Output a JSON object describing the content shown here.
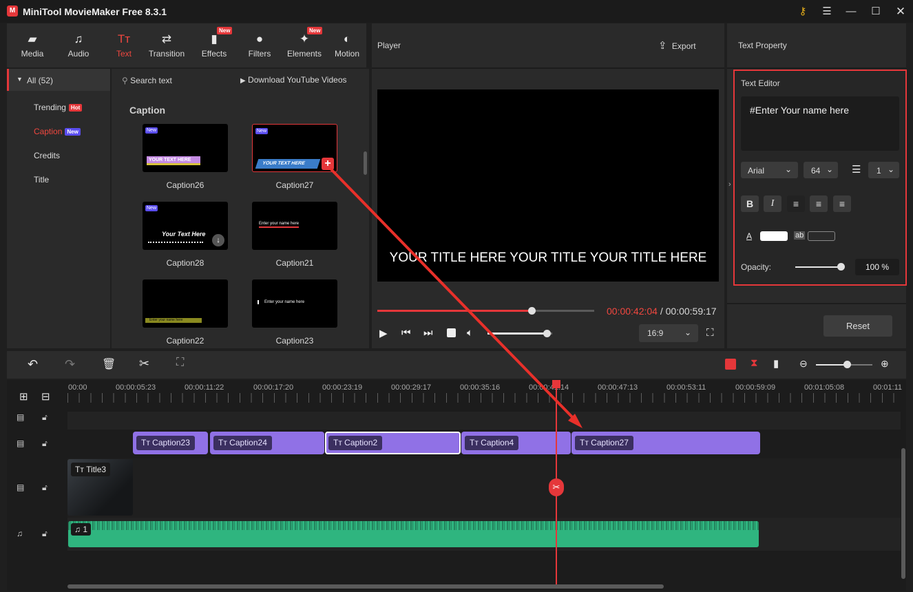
{
  "app": {
    "title": "MiniTool MovieMaker Free 8.3.1",
    "logo": "M"
  },
  "window_controls": [
    "key-icon",
    "menu-icon",
    "minimize-icon",
    "maximize-icon",
    "close-icon"
  ],
  "media_tabs": [
    {
      "label": "Media",
      "icon": "▰"
    },
    {
      "label": "Audio",
      "icon": "♫"
    },
    {
      "label": "Text",
      "icon": "Tт"
    },
    {
      "label": "Transition",
      "icon": "⇄"
    },
    {
      "label": "Effects",
      "icon": "▮",
      "badge": "New"
    },
    {
      "label": "Filters",
      "icon": "●"
    },
    {
      "label": "Elements",
      "icon": "✦",
      "badge": "New"
    },
    {
      "label": "Motion",
      "icon": "◐"
    }
  ],
  "categories": {
    "all": "All (52)",
    "items": [
      {
        "label": "Trending",
        "badge": "Hot"
      },
      {
        "label": "Caption",
        "badge": "New"
      },
      {
        "label": "Credits"
      },
      {
        "label": "Title"
      }
    ]
  },
  "browser": {
    "search_placeholder": "Search text",
    "download_label": "Download YouTube Videos",
    "section_title": "Caption",
    "new_badge": "New",
    "thumbs": [
      {
        "name": "Caption26",
        "preview": "YOUR TEXT HERE"
      },
      {
        "name": "Caption27",
        "preview": "YOUR TEXT HERE"
      },
      {
        "name": "Caption28",
        "preview": "Your Text Here"
      },
      {
        "name": "Caption21",
        "preview": "Enter your name here"
      },
      {
        "name": "Caption22",
        "preview": "Enter your name here"
      },
      {
        "name": "Caption23",
        "preview": "Enter your name here"
      }
    ]
  },
  "player": {
    "title": "Player",
    "export_label": "Export",
    "overlay_text": "YOUR TITLE HERE YOUR TITLE YOUR TITLE HERE",
    "current_time": "00:00:42:04",
    "total_time": " / 00:00:59:17",
    "progress": 0.71,
    "volume": 0.92,
    "aspect": "16:9"
  },
  "text_property": {
    "title": "Text Property",
    "editor_label": "Text Editor",
    "text_value": "#Enter Your name here",
    "font": "Arial",
    "font_size": "64",
    "line_spacing": "1",
    "opacity_label": "Opacity:",
    "opacity_value": "100 %",
    "opacity": 1.0,
    "bg_label": "ab",
    "reset_label": "Reset"
  },
  "timeline": {
    "ticks": [
      "00:00",
      "00:00:05:23",
      "00:00:11:22",
      "00:00:17:20",
      "00:00:23:19",
      "00:00:29:17",
      "00:00:35:16",
      "00:00:41:14",
      "00:00:47:13",
      "00:00:53:11",
      "00:00:59:09",
      "00:01:05:08",
      "00:01:11"
    ],
    "text_clips": [
      "Caption23",
      "Caption24",
      "Caption2",
      "Caption4",
      "Caption27"
    ],
    "video_clip": "Title3",
    "audio_clip": "1",
    "zoom": 0.55
  },
  "colors": {
    "accent": "#e5373a",
    "clip_purple": "#9071e6",
    "audio_green": "#2fb57f"
  }
}
